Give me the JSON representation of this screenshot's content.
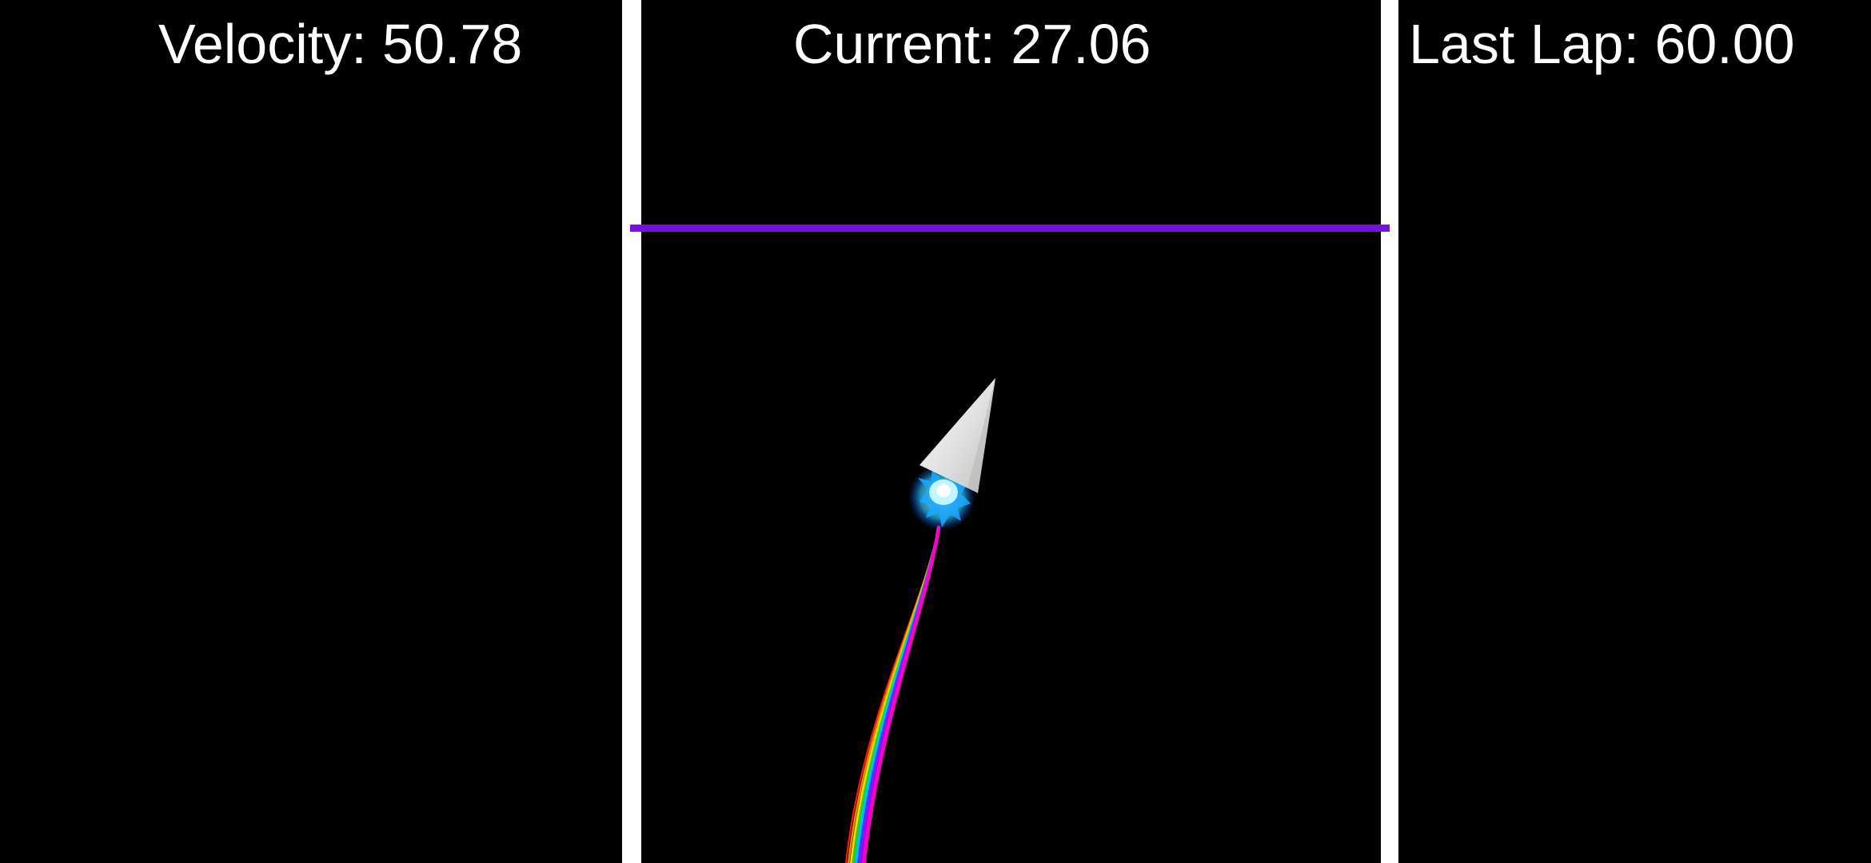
{
  "hud": {
    "velocity_label": "Velocity: 50.78",
    "current_label": "Current: 27.06",
    "last_lap_label": "Last Lap: 60.00"
  },
  "colors": {
    "background": "#000000",
    "track_wall": "#ffffff",
    "finish_line": "#7a0fe0",
    "ship": "#e6e6e6",
    "thruster_glow": "#27c6ff",
    "trail": [
      "#ff1a1a",
      "#ff8c00",
      "#ffe600",
      "#22dd22",
      "#00c8ff",
      "#2b4bff",
      "#b000ff",
      "#ff00c8"
    ]
  },
  "icons": {
    "ship": "triangle-ship-icon",
    "thruster": "thruster-flame-icon",
    "trail": "rainbow-trail-icon"
  }
}
